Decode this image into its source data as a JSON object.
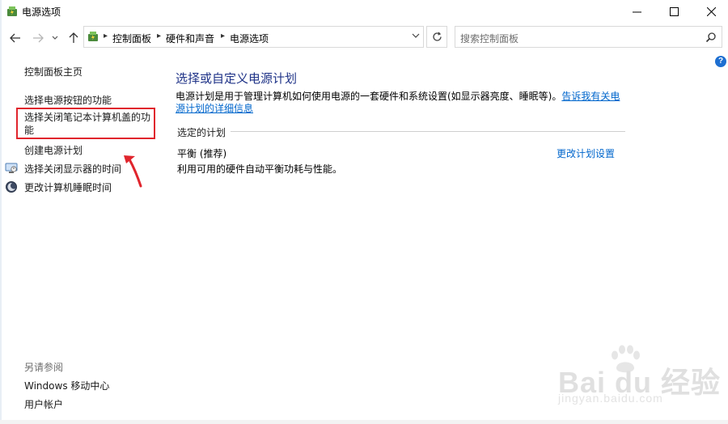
{
  "window": {
    "title": "电源选项",
    "icons": {
      "app": "power-options-icon",
      "minimize": "minimize-icon",
      "maximize": "maximize-icon",
      "close": "close-icon"
    }
  },
  "nav": {
    "breadcrumb": [
      "控制面板",
      "硬件和声音",
      "电源选项"
    ],
    "search_placeholder": "搜索控制面板"
  },
  "sidebar": {
    "home": "控制面板主页",
    "items": [
      {
        "label": "选择电源按钮的功能",
        "icon": ""
      },
      {
        "label": "选择关闭笔记本计算机盖的功能",
        "icon": ""
      },
      {
        "label": "创建电源计划",
        "icon": ""
      },
      {
        "label": "选择关闭显示器的时间",
        "icon": "monitor-icon"
      },
      {
        "label": "更改计算机睡眠时间",
        "icon": "moon-icon"
      }
    ],
    "see_also_title": "另请参阅",
    "see_also": [
      "Windows 移动中心",
      "用户帐户"
    ]
  },
  "main": {
    "title": "选择或自定义电源计划",
    "description": "电源计划是用于管理计算机如何使用电源的一套硬件和系统设置(如显示器亮度、睡眠等)。",
    "description_link": "告诉我有关电源计划的详细信息",
    "section_label": "选定的计划",
    "plan_name": "平衡 (推荐)",
    "plan_description": "利用可用的硬件自动平衡功耗与性能。",
    "plan_link": "更改计划设置"
  },
  "watermark": {
    "brand": "Bai du 经验",
    "url": "jingyan.baidu.com"
  },
  "colors": {
    "link": "#0066cc",
    "title": "#1e3287",
    "highlight": "#e0252d"
  }
}
